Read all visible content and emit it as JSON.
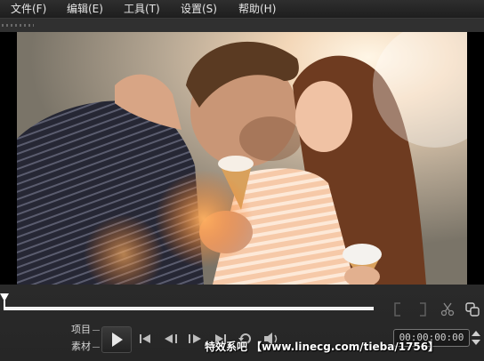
{
  "menu": {
    "items": [
      "文件(F)",
      "编辑(E)",
      "工具(T)",
      "设置(S)",
      "帮助(H)"
    ]
  },
  "playback": {
    "mode_project_label": "项目",
    "mode_clip_label": "素材",
    "timecode": "00:00:00:00",
    "progress": 1.0
  },
  "icons": {
    "play": "play-icon",
    "home": "go-to-start-icon",
    "prev_frame": "previous-frame-icon",
    "next_frame": "next-frame-icon",
    "end": "go-to-end-icon",
    "repeat": "repeat-icon",
    "volume": "volume-icon",
    "mark_in": "mark-in-bracket-icon",
    "mark_out": "mark-out-bracket-icon",
    "split": "scissors-icon",
    "copy": "copy-icon"
  },
  "watermark": "特效系吧 【www.linecg.com/tieba/1756】",
  "colors": {
    "background": "#2b2b2b",
    "scrub_track": "#f2f2f2"
  }
}
